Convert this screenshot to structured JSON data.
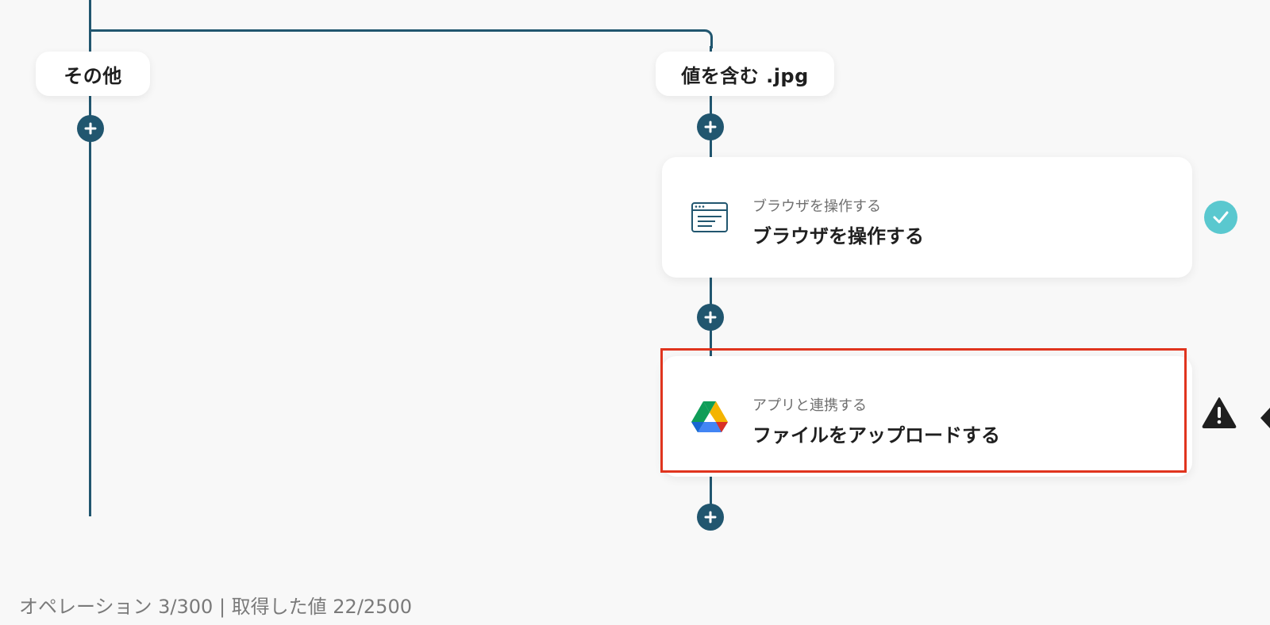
{
  "branches": {
    "other_label": "その他",
    "match_label": "値を含む .jpg"
  },
  "steps": [
    {
      "kind": "ブラウザを操作する",
      "title": "ブラウザを操作する",
      "icon": "browser-window-icon",
      "status": "completed"
    },
    {
      "kind": "アプリと連携する",
      "title": "ファイルをアップロードする",
      "icon": "google-drive-icon",
      "status": "warning"
    }
  ],
  "footer": {
    "usage": "オペレーション 3/300 | 取得した値 22/2500"
  },
  "colors": {
    "connector": "#21566f",
    "success": "#5ac8cf",
    "highlight": "#e0341e",
    "background": "#f8f8f8"
  }
}
